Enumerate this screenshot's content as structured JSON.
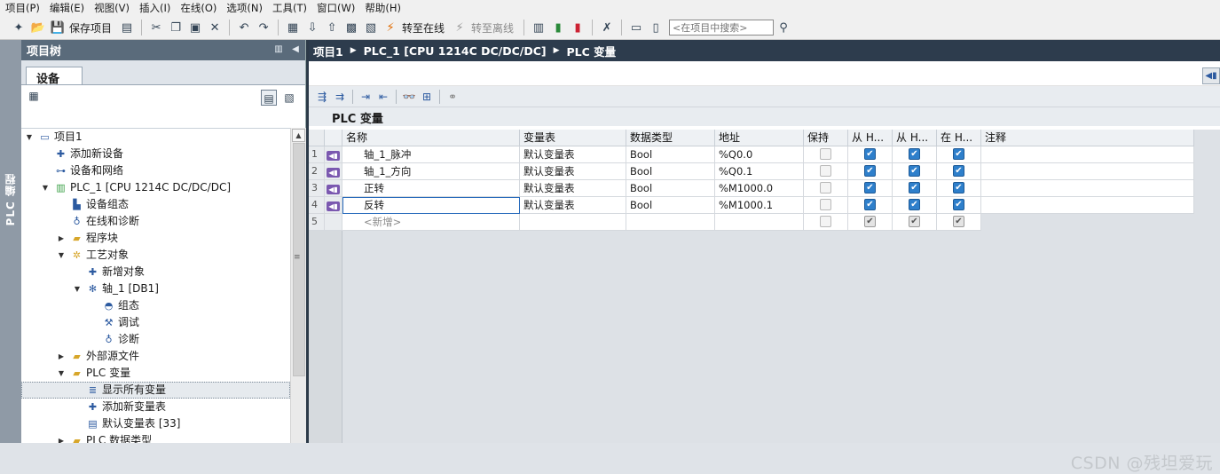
{
  "menu": {
    "items": [
      "项目(P)",
      "编辑(E)",
      "视图(V)",
      "插入(I)",
      "在线(O)",
      "选项(N)",
      "工具(T)",
      "窗口(W)",
      "帮助(H)"
    ]
  },
  "toolbar": {
    "save_project": "保存项目",
    "go_online": "转至在线",
    "go_offline": "转至离线",
    "search_placeholder": "<在项目中搜索>"
  },
  "vertical_tab": {
    "label": "PLC 编程"
  },
  "project_tree": {
    "title": "项目树",
    "tab": "设备",
    "rows": [
      {
        "label": "项目1",
        "icon": "project-icon",
        "expander": "expanded"
      },
      {
        "label": "添加新设备",
        "icon": "add-device-icon",
        "expander": ""
      },
      {
        "label": "设备和网络",
        "icon": "network-icon",
        "expander": ""
      },
      {
        "label": "PLC_1 [CPU 1214C DC/DC/DC]",
        "icon": "plc-icon",
        "expander": "expanded"
      },
      {
        "label": "设备组态",
        "icon": "device-config-icon",
        "expander": ""
      },
      {
        "label": "在线和诊断",
        "icon": "online-diagnostics-icon",
        "expander": ""
      },
      {
        "label": "程序块",
        "icon": "folder-icon",
        "expander": "collapsed"
      },
      {
        "label": "工艺对象",
        "icon": "tech-objects-folder-icon",
        "expander": "expanded"
      },
      {
        "label": "新增对象",
        "icon": "add-object-icon",
        "expander": ""
      },
      {
        "label": "轴_1 [DB1]",
        "icon": "axis-icon",
        "expander": "expanded"
      },
      {
        "label": "组态",
        "icon": "configuration-icon",
        "expander": ""
      },
      {
        "label": "调试",
        "icon": "commissioning-icon",
        "expander": ""
      },
      {
        "label": "诊断",
        "icon": "diagnostics-icon",
        "expander": ""
      },
      {
        "label": "外部源文件",
        "icon": "folder-icon",
        "expander": "collapsed"
      },
      {
        "label": "PLC 变量",
        "icon": "folder-icon",
        "expander": "expanded"
      },
      {
        "label": "显示所有变量",
        "icon": "show-tags-icon",
        "expander": ""
      },
      {
        "label": "添加新变量表",
        "icon": "add-tag-table-icon",
        "expander": ""
      },
      {
        "label": "默认变量表 [33]",
        "icon": "tag-table-icon",
        "expander": ""
      },
      {
        "label": "PLC 数据类型",
        "icon": "folder-icon",
        "expander": "collapsed"
      }
    ]
  },
  "breadcrumb": [
    "项目1",
    "PLC_1 [CPU 1214C DC/DC/DC]",
    "PLC 变量"
  ],
  "editor": {
    "title": "PLC 变量"
  },
  "table": {
    "headers": [
      "名称",
      "变量表",
      "数据类型",
      "地址",
      "保持",
      "从 H...",
      "从 H...",
      "在 H...",
      "注释"
    ],
    "rows": [
      {
        "num": "1",
        "name": "轴_1_脉冲",
        "table": "默认变量表",
        "type": "Bool",
        "address": "%Q0.0",
        "retain": false,
        "hmi_access": true,
        "hmi_write": true,
        "hmi_visible": true,
        "comment": ""
      },
      {
        "num": "2",
        "name": "轴_1_方向",
        "table": "默认变量表",
        "type": "Bool",
        "address": "%Q0.1",
        "retain": false,
        "hmi_access": true,
        "hmi_write": true,
        "hmi_visible": true,
        "comment": ""
      },
      {
        "num": "3",
        "name": "正转",
        "table": "默认变量表",
        "type": "Bool",
        "address": "%M1000.0",
        "retain": false,
        "hmi_access": true,
        "hmi_write": true,
        "hmi_visible": true,
        "comment": ""
      },
      {
        "num": "4",
        "name": "反转",
        "table": "默认变量表",
        "type": "Bool",
        "address": "%M1000.1",
        "retain": false,
        "hmi_access": true,
        "hmi_write": true,
        "hmi_visible": true,
        "comment": ""
      }
    ],
    "new_row": {
      "num": "5",
      "placeholder": "<新增>"
    }
  },
  "watermark": "CSDN @残坦爱玩"
}
